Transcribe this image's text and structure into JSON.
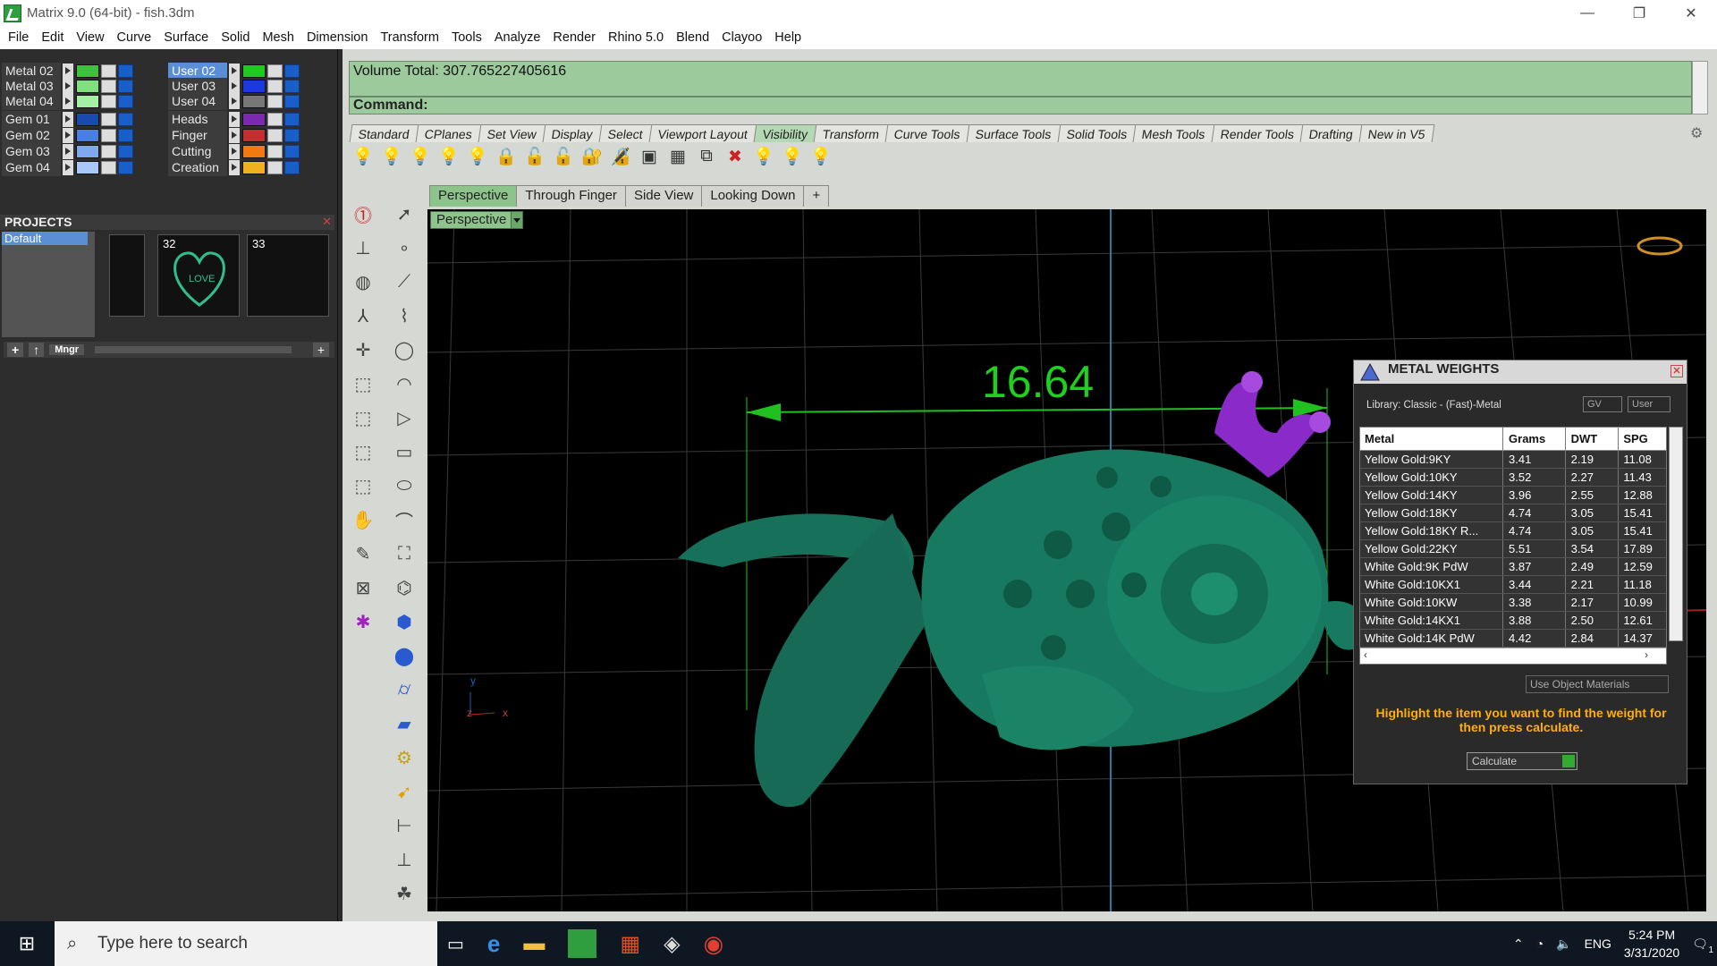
{
  "window": {
    "title": "Matrix 9.0 (64-bit) - fish.3dm",
    "controls": [
      "—",
      "❐",
      "✕"
    ]
  },
  "menu": [
    "File",
    "Edit",
    "View",
    "Curve",
    "Surface",
    "Solid",
    "Mesh",
    "Dimension",
    "Transform",
    "Tools",
    "Analyze",
    "Render",
    "Rhino 5.0",
    "Blend",
    "Clayoo",
    "Help"
  ],
  "layers": {
    "left": [
      {
        "name": "Metal 02",
        "color": "#3fc13f"
      },
      {
        "name": "Metal 03",
        "color": "#7fe07f"
      },
      {
        "name": "Metal 04",
        "color": "#a4f0a4"
      },
      {
        "name": "Gem 01",
        "color": "#1a4ab0"
      },
      {
        "name": "Gem 02",
        "color": "#4a7ee0"
      },
      {
        "name": "Gem 03",
        "color": "#7ea8f0"
      },
      {
        "name": "Gem 04",
        "color": "#a8c8f8"
      }
    ],
    "right": [
      {
        "name": "User 02",
        "color": "#22c822",
        "selected": true
      },
      {
        "name": "User 03",
        "color": "#1a3ae0"
      },
      {
        "name": "User 04",
        "color": "#777777"
      },
      {
        "name": "Heads",
        "color": "#7a2ab0"
      },
      {
        "name": "Finger",
        "color": "#c03030"
      },
      {
        "name": "Cutting",
        "color": "#f07a10"
      },
      {
        "name": "Creation",
        "color": "#f0b020"
      }
    ]
  },
  "projects": {
    "header": "PROJECTS",
    "items": [
      "Default"
    ],
    "thumbs": [
      "",
      "32",
      "33"
    ],
    "mgr_label": "Mngr"
  },
  "volume_text": "Volume Total: 307.765227405616",
  "command_label": "Command:",
  "toolbar_tabs": [
    "Standard",
    "CPlanes",
    "Set View",
    "Display",
    "Select",
    "Viewport Layout",
    "Visibility",
    "Transform",
    "Curve Tools",
    "Surface Tools",
    "Solid Tools",
    "Mesh Tools",
    "Render Tools",
    "Drafting",
    "New in V5"
  ],
  "active_toolbar_tab": "Visibility",
  "viewport_tabs": [
    "Perspective",
    "Through Finger",
    "Side View",
    "Looking Down",
    "+"
  ],
  "viewport_label": "Perspective",
  "dimension_value": "16.64",
  "axis_labels": {
    "y": "y",
    "z": "z",
    "x": "x"
  },
  "metal_weights": {
    "title": "METAL WEIGHTS",
    "library": "Library: Classic - (Fast)-Metal",
    "gv_label": "GV",
    "user_label": "User",
    "columns": [
      "Metal",
      "Grams",
      "DWT",
      "SPG"
    ],
    "rows": [
      [
        "Yellow Gold:9KY",
        "3.41",
        "2.19",
        "11.08"
      ],
      [
        "Yellow Gold:10KY",
        "3.52",
        "2.27",
        "11.43"
      ],
      [
        "Yellow Gold:14KY",
        "3.96",
        "2.55",
        "12.88"
      ],
      [
        "Yellow Gold:18KY",
        "4.74",
        "3.05",
        "15.41"
      ],
      [
        "Yellow Gold:18KY R...",
        "4.74",
        "3.05",
        "15.41"
      ],
      [
        "Yellow Gold:22KY",
        "5.51",
        "3.54",
        "17.89"
      ],
      [
        "White Gold:9K PdW",
        "3.87",
        "2.49",
        "12.59"
      ],
      [
        "White Gold:10KX1",
        "3.44",
        "2.21",
        "11.18"
      ],
      [
        "White Gold:10KW",
        "3.38",
        "2.17",
        "10.99"
      ],
      [
        "White Gold:14KX1",
        "3.88",
        "2.50",
        "12.61"
      ],
      [
        "White Gold:14K PdW",
        "4.42",
        "2.84",
        "14.37"
      ]
    ],
    "use_object_materials": "Use Object Materials",
    "hint": "Highlight the item you want to find the weight for then press calculate.",
    "calculate": "Calculate"
  },
  "taskbar": {
    "search_placeholder": "Type here to search",
    "time": "5:24 PM",
    "date": "3/31/2020",
    "lang": "ENG",
    "notif_count": "1"
  }
}
